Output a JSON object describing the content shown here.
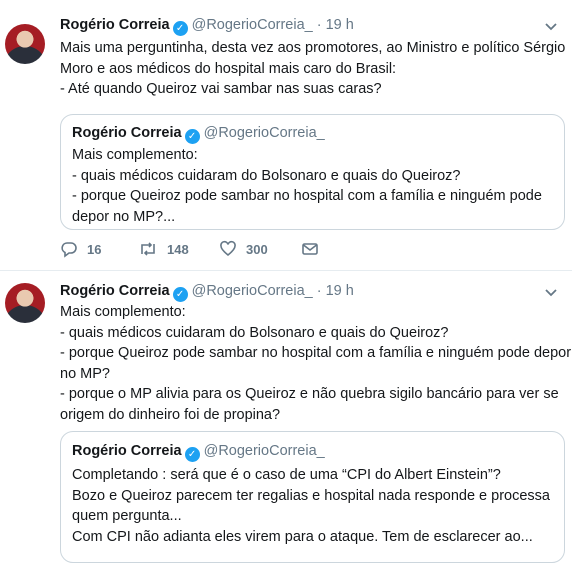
{
  "tweets": [
    {
      "name": "Rogério Correia",
      "verified_glyph": "✓",
      "handle": "@RogerioCorreia_",
      "dot": "·",
      "time": "19 h",
      "body_lines": [
        "Mais uma perguntinha, desta vez aos promotores, ao Ministro e político Sérgio",
        "Moro e aos médicos do hospital mais caro do Brasil:",
        "- Até quando Queiroz vai sambar nas suas caras?"
      ],
      "quote": {
        "name": "Rogério Correia",
        "handle": "@RogerioCorreia_",
        "body_lines": [
          "Mais complemento:",
          "- quais médicos cuidaram do Bolsonaro e quais do Queiroz?",
          "- porque Queiroz pode sambar no hospital com a família e ninguém pode",
          "depor no MP?..."
        ]
      },
      "actions": {
        "replies": "16",
        "retweets": "148",
        "likes": "300"
      }
    },
    {
      "name": "Rogério Correia",
      "verified_glyph": "✓",
      "handle": "@RogerioCorreia_",
      "dot": "·",
      "time": "19 h",
      "body_lines": [
        "Mais complemento:",
        "- quais médicos cuidaram do Bolsonaro e quais do Queiroz?",
        "- porque Queiroz pode sambar no hospital com a família e ninguém pode depor",
        "no MP?",
        "- porque o MP alivia para os Queiroz e não quebra sigilo bancário para ver se",
        "origem do dinheiro foi de propina?"
      ],
      "quote": {
        "name": "Rogério Correia",
        "handle": "@RogerioCorreia_",
        "body_lines": [
          "Completando : será que é o caso de uma “CPI do Albert Einstein”?",
          "Bozo e Queiroz parecem ter regalias e hospital nada responde e processa",
          "quem pergunta...",
          "Com CPI não adianta eles virem para o ataque. Tem de esclarecer ao..."
        ]
      }
    }
  ],
  "icons": {
    "chevron": "chevron-down-icon",
    "reply": "reply-icon",
    "retweet": "retweet-icon",
    "like": "heart-icon",
    "dm": "message-icon"
  },
  "colors": {
    "accent": "#1da1f2",
    "muted": "#657786",
    "border": "#ccd6dd"
  }
}
